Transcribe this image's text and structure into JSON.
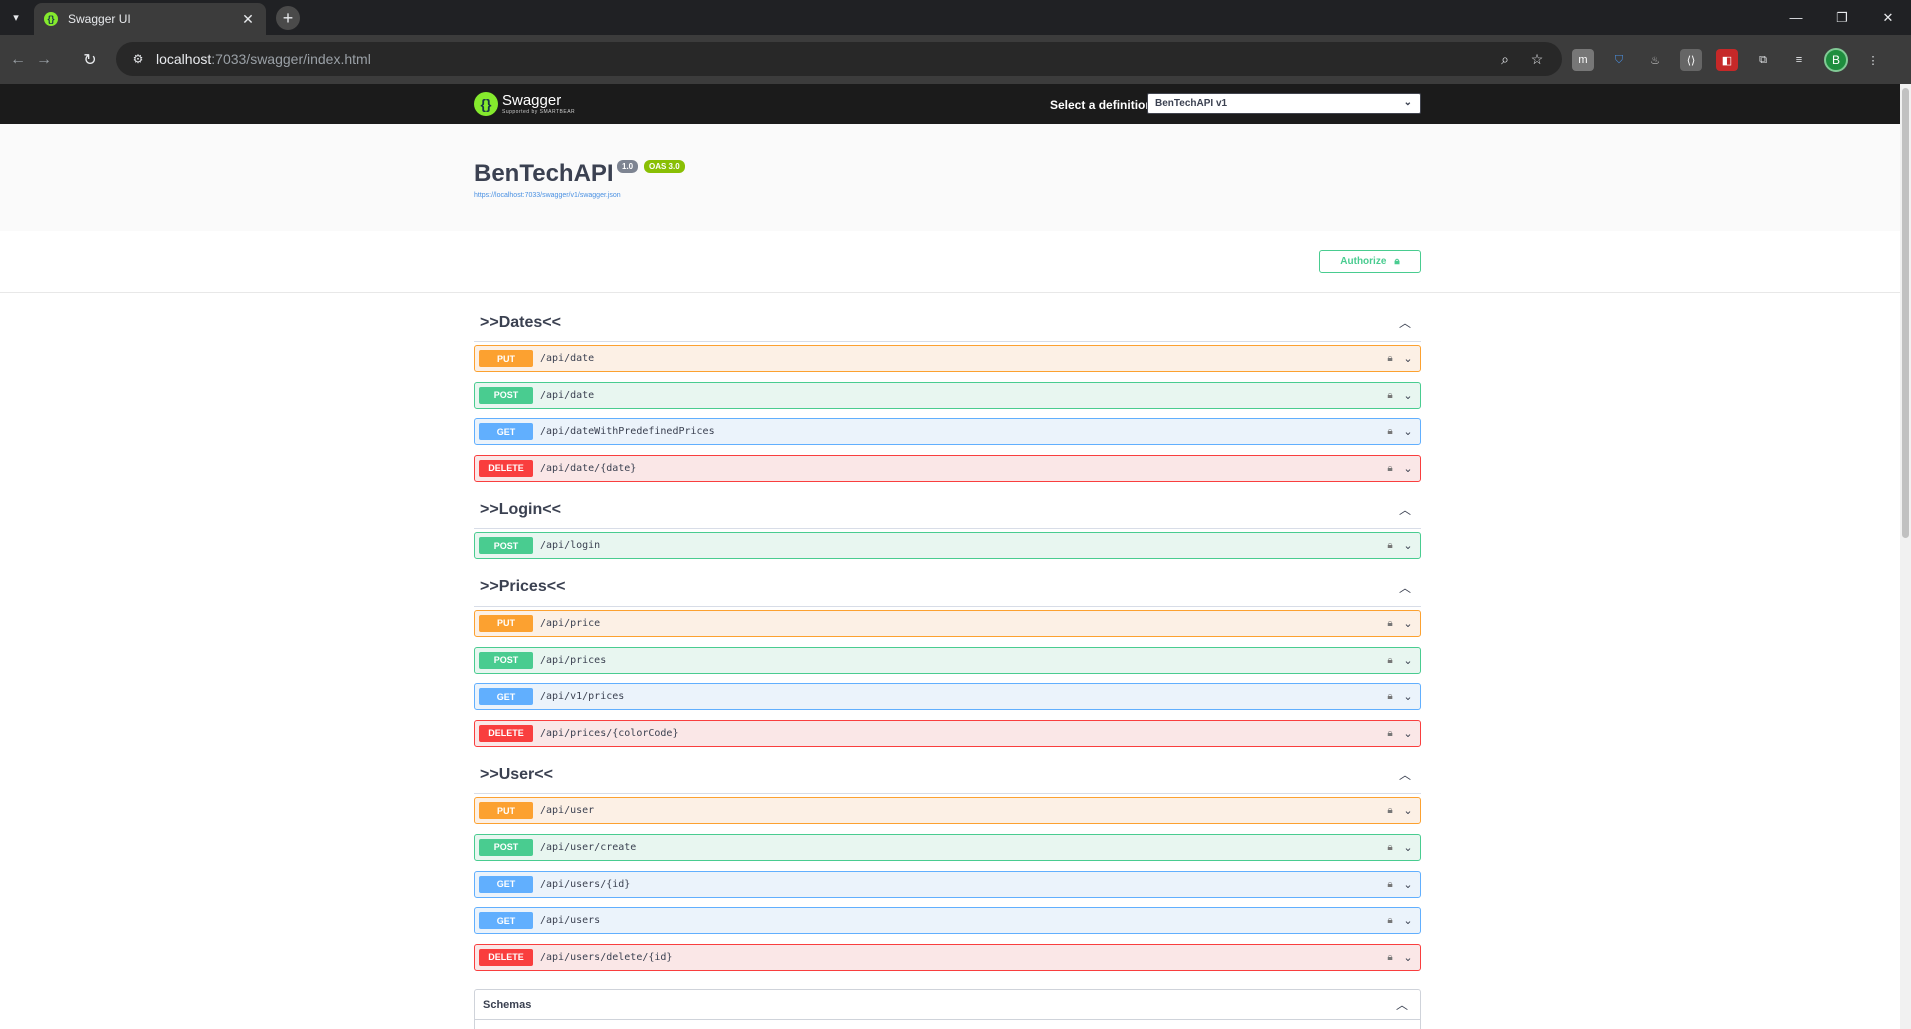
{
  "browser": {
    "tab_title": "Swagger UI",
    "url_host": "localhost",
    "url_rest": ":7033/swagger/index.html",
    "avatar_letter": "B",
    "icons": [
      "search-icon",
      "star-icon",
      "extensions-icon"
    ]
  },
  "swagger": {
    "logo_text": "Swagger",
    "logo_sub": "Supported by SMARTBEAR",
    "definition_label": "Select a definition",
    "definition_value": "BenTechAPI v1",
    "api_title": "BenTechAPI",
    "version": "1.0",
    "oas": "OAS 3.0",
    "spec_url": "https://localhost:7033/swagger/v1/swagger.json",
    "authorize_label": "Authorize",
    "schemas_label": "Schemas"
  },
  "tags": [
    {
      "name": ">>Dates<<",
      "ops": [
        {
          "method": "PUT",
          "path": "/api/date"
        },
        {
          "method": "POST",
          "path": "/api/date"
        },
        {
          "method": "GET",
          "path": "/api/dateWithPredefinedPrices"
        },
        {
          "method": "DELETE",
          "path": "/api/date/{date}"
        }
      ]
    },
    {
      "name": ">>Login<<",
      "ops": [
        {
          "method": "POST",
          "path": "/api/login"
        }
      ]
    },
    {
      "name": ">>Prices<<",
      "ops": [
        {
          "method": "PUT",
          "path": "/api/price"
        },
        {
          "method": "POST",
          "path": "/api/prices"
        },
        {
          "method": "GET",
          "path": "/api/v1/prices"
        },
        {
          "method": "DELETE",
          "path": "/api/prices/{colorCode}"
        }
      ]
    },
    {
      "name": ">>User<<",
      "ops": [
        {
          "method": "PUT",
          "path": "/api/user"
        },
        {
          "method": "POST",
          "path": "/api/user/create"
        },
        {
          "method": "GET",
          "path": "/api/users/{id}"
        },
        {
          "method": "GET",
          "path": "/api/users"
        },
        {
          "method": "DELETE",
          "path": "/api/users/delete/{id}"
        }
      ]
    }
  ],
  "colors": {
    "put": "#fca130",
    "post": "#49cc90",
    "get": "#61affe",
    "delete": "#f93e3e"
  }
}
